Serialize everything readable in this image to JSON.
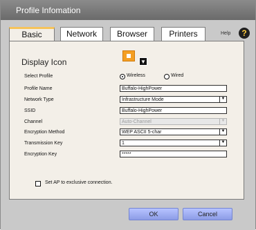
{
  "window": {
    "title": "Profile Infomation"
  },
  "tabs": [
    {
      "label": "Basic",
      "active": true
    },
    {
      "label": "Network",
      "active": false
    },
    {
      "label": "Browser",
      "active": false
    },
    {
      "label": "Printers",
      "active": false
    }
  ],
  "help": {
    "label": "Help",
    "icon": "?"
  },
  "display_icon": {
    "label": "Display Icon",
    "icon_name": "house-icon",
    "dropdown_icon": "▼"
  },
  "form": {
    "select_profile_label": "Select Profile",
    "radio_wireless_label": "Wireless",
    "radio_wired_label": "Wired",
    "profile_name_label": "Profile Name",
    "profile_name_value": "Buffalo-HighPower",
    "network_type_label": "Network Type",
    "network_type_value": "Infrastructure Mode",
    "ssid_label": "SSID",
    "ssid_value": "Buffalo-HighPower",
    "channel_label": "Channel",
    "channel_value": "Auto-Channel",
    "encryption_method_label": "Encryption Method",
    "encryption_method_value": "WEP ASCII 5-char",
    "transmission_key_label": "Transmission Key",
    "transmission_key_value": "1",
    "encryption_key_label": "Encryption Key",
    "encryption_key_value": "*****",
    "exclusive_label": "Set AP to exclusive connection."
  },
  "buttons": {
    "ok_label": "OK",
    "cancel_label": "Cancel"
  },
  "colors": {
    "accent": "#f6c35a",
    "button": "#9aa8ef"
  }
}
